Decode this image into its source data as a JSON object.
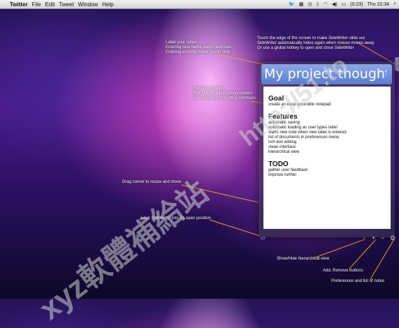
{
  "menubar": {
    "app_name": "Twitter",
    "items": [
      "File",
      "Edit",
      "Tweet",
      "Window",
      "Help"
    ],
    "battery": "(0:23)",
    "clock": "Thu 22:34"
  },
  "annotations": {
    "label_notes": "Label your notes\nEntering new name starts new note\nEntering existing name opens note",
    "edge_touch": "Touch the edge of the screen to make SideWriter slide out\nSideWriter automatically hides again when mouse moves away\nOr use a global hotkey to open and close SideWriter",
    "rich_text": "Rich Text Editing\nRight click for formatting options\nUse standard formatting shortcuts",
    "resize_move": "Drag corner to resize and move",
    "lock": "Lock SideWriter into it's open position",
    "hierarchical": "Show/Hide hierarchical view",
    "add_remove": "Add, Remove buttons",
    "preferences": "Preferences and list of notes"
  },
  "note": {
    "title": "My project thoughts",
    "sections": [
      {
        "heading": "Goal",
        "lines": [
          "create an easy accesible notepad"
        ]
      },
      {
        "heading": "Features",
        "lines": [
          "automatic saving",
          "automatic loading as user types label",
          "starts new note when new label is entered",
          "list of documents in preferences menu",
          "rich text editing",
          "clean interface",
          "hierarchical view"
        ]
      },
      {
        "heading": "TODO",
        "lines": [
          "gather user feedback",
          "improve further"
        ]
      }
    ]
  },
  "watermark": {
    "main": "xyz軟體補給站",
    "url": "http://51.to"
  }
}
